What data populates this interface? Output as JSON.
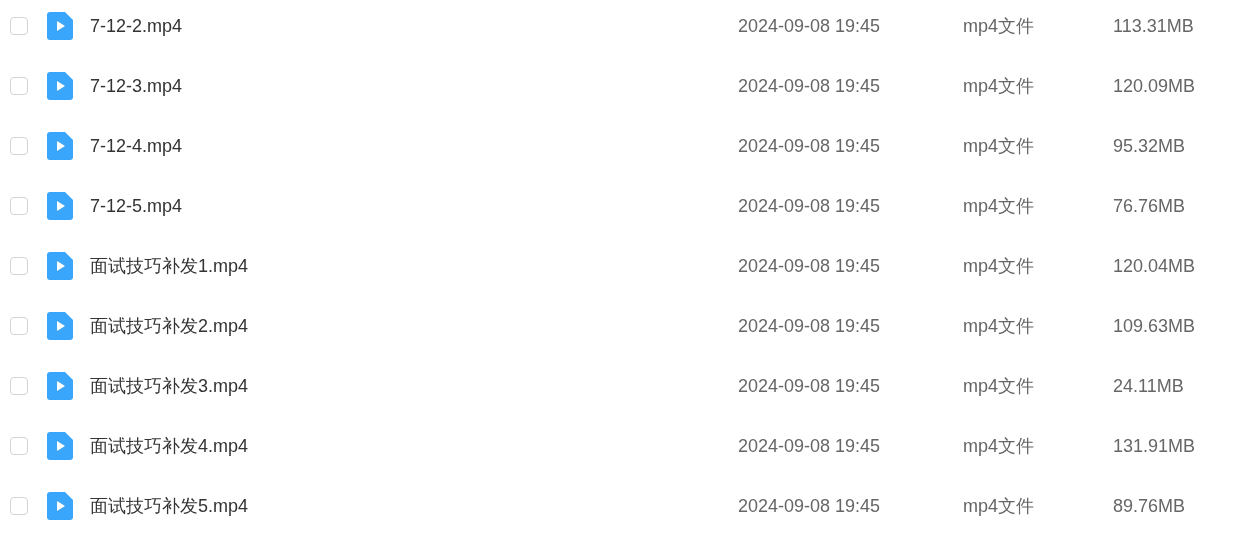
{
  "files": [
    {
      "name": "7-12-2.mp4",
      "modified": "2024-09-08 19:45",
      "type": "mp4文件",
      "size": "113.31MB",
      "checked": false
    },
    {
      "name": "7-12-3.mp4",
      "modified": "2024-09-08 19:45",
      "type": "mp4文件",
      "size": "120.09MB",
      "checked": false
    },
    {
      "name": "7-12-4.mp4",
      "modified": "2024-09-08 19:45",
      "type": "mp4文件",
      "size": "95.32MB",
      "checked": false
    },
    {
      "name": "7-12-5.mp4",
      "modified": "2024-09-08 19:45",
      "type": "mp4文件",
      "size": "76.76MB",
      "checked": false
    },
    {
      "name": "面试技巧补发1.mp4",
      "modified": "2024-09-08 19:45",
      "type": "mp4文件",
      "size": "120.04MB",
      "checked": false
    },
    {
      "name": "面试技巧补发2.mp4",
      "modified": "2024-09-08 19:45",
      "type": "mp4文件",
      "size": "109.63MB",
      "checked": false
    },
    {
      "name": "面试技巧补发3.mp4",
      "modified": "2024-09-08 19:45",
      "type": "mp4文件",
      "size": "24.11MB",
      "checked": false
    },
    {
      "name": "面试技巧补发4.mp4",
      "modified": "2024-09-08 19:45",
      "type": "mp4文件",
      "size": "131.91MB",
      "checked": false
    },
    {
      "name": "面试技巧补发5.mp4",
      "modified": "2024-09-08 19:45",
      "type": "mp4文件",
      "size": "89.76MB",
      "checked": false
    }
  ]
}
